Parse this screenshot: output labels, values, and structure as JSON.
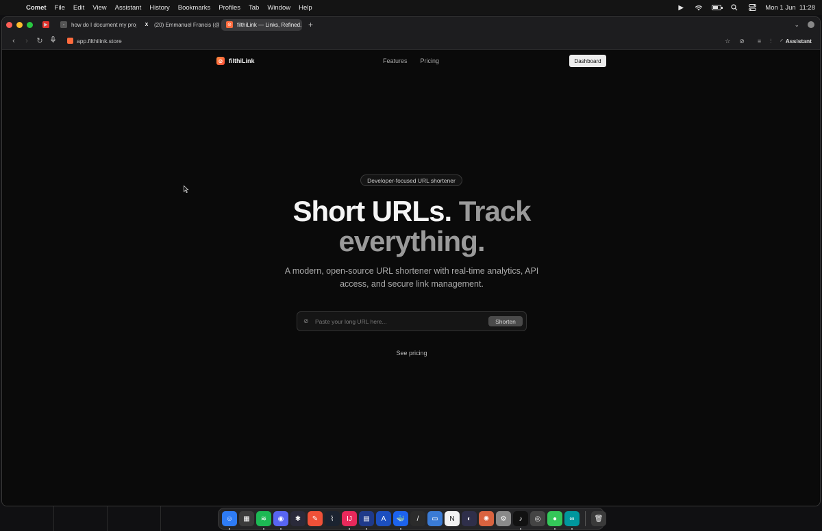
{
  "menubar": {
    "app": "Comet",
    "items": [
      "File",
      "Edit",
      "View",
      "Assistant",
      "History",
      "Bookmarks",
      "Profiles",
      "Tab",
      "Window",
      "Help"
    ],
    "datetime": "Mon 1 Jun  11:28"
  },
  "tabs": [
    {
      "title": "",
      "favicon": "youtube-icon",
      "color": "#e2342e"
    },
    {
      "title": "how do I document my proje",
      "favicon": "chat-icon",
      "color": "#555555"
    },
    {
      "title": "(20) Emmanuel Francis (@p",
      "favicon": "x-icon",
      "color": "#000000"
    },
    {
      "title": "filthiLink — Links, Refined.",
      "favicon": "link-icon",
      "color": "#ff6b3d",
      "active": true
    }
  ],
  "address": {
    "url": "app.filthilink.store",
    "assistant_label": "Assistant"
  },
  "site": {
    "brand": "filthiLink",
    "nav": [
      "Features",
      "Pricing"
    ],
    "dashboard_label": "Dashboard",
    "badge": "Developer-focused URL shortener",
    "headline_white": "Short URLs.",
    "headline_gray_1": "Track",
    "headline_gray_2": "everything.",
    "subtitle": "A modern, open-source URL shortener with real-time analytics, API access, and secure link management.",
    "input_placeholder": "Paste your long URL here...",
    "shorten_label": "Shorten",
    "see_pricing": "See pricing"
  },
  "dock": [
    {
      "name": "finder-icon",
      "color": "#2e7cf6",
      "glyph": "☺"
    },
    {
      "name": "launchpad-icon",
      "color": "#3b3b3b",
      "glyph": "▦"
    },
    {
      "name": "spotify-icon",
      "color": "#1db954",
      "glyph": "≋"
    },
    {
      "name": "discord-icon",
      "color": "#5865f2",
      "glyph": "◉"
    },
    {
      "name": "davinci-icon",
      "color": "#2a2a3a",
      "glyph": "✱"
    },
    {
      "name": "swift-icon",
      "color": "#f05138",
      "glyph": "✎"
    },
    {
      "name": "wave-icon",
      "color": "#1b2330",
      "glyph": "⌇"
    },
    {
      "name": "intellij-icon",
      "color": "#e8295b",
      "glyph": "IJ"
    },
    {
      "name": "doc-icon",
      "color": "#1f3a8a",
      "glyph": "▤"
    },
    {
      "name": "xcode-icon",
      "color": "#1c4fbf",
      "glyph": "A"
    },
    {
      "name": "docker-icon",
      "color": "#1d63ed",
      "glyph": "🐳"
    },
    {
      "name": "pen-icon",
      "color": "#2b2b2b",
      "glyph": "/"
    },
    {
      "name": "files-icon",
      "color": "#3a7bd5",
      "glyph": "▭"
    },
    {
      "name": "notion-icon",
      "color": "#f2f2f2",
      "glyph": "N"
    },
    {
      "name": "obs-icon",
      "color": "#2f2f4a",
      "glyph": "◐"
    },
    {
      "name": "claude-icon",
      "color": "#d9633f",
      "glyph": "✺"
    },
    {
      "name": "settings-icon",
      "color": "#8a8a8a",
      "glyph": "⚙"
    },
    {
      "name": "tiktok-icon",
      "color": "#111111",
      "glyph": "♪"
    },
    {
      "name": "chrome-icon",
      "color": "#444444",
      "glyph": "◎"
    },
    {
      "name": "messages-icon",
      "color": "#34c759",
      "glyph": "●"
    },
    {
      "name": "infinity-icon",
      "color": "#00979d",
      "glyph": "∞"
    },
    {
      "name": "trash-icon",
      "color": "#3a3a3a",
      "glyph": "🗑"
    }
  ]
}
